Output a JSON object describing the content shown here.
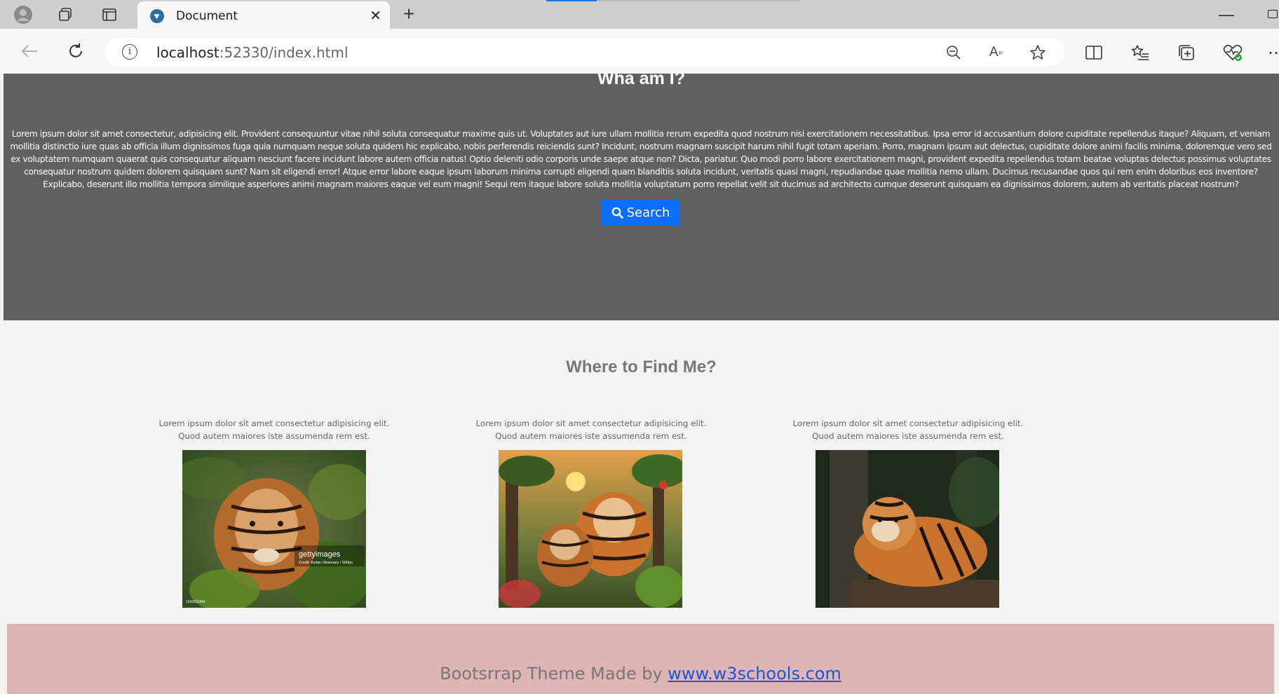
{
  "browser": {
    "tab_title": "Document",
    "url_host": "localhost",
    "url_rest": ":52330/index.html"
  },
  "hero": {
    "title": "Wha am I?",
    "body": "Lorem ipsum dolor sit amet consectetur, adipisicing elit. Provident consequuntur vitae nihil soluta consequatur maxime quis ut. Voluptates aut iure ullam mollitia rerum expedita quod nostrum nisi exercitationem necessitatibus. Ipsa error id accusantium dolore cupiditate repellendus itaque? Aliquam, et veniam mollitia distinctio iure quas ab officia illum dignissimos fuga quia numquam neque soluta quidem hic explicabo, nobis perferendis reiciendis sunt? Incidunt, nostrum magnam suscipit harum nihil fugit totam aperiam. Porro, magnam ipsum aut delectus, cupiditate dolore animi facilis minima, doloremque vero sed ex voluptatem numquam quaerat quis consequatur aliquam nesciunt facere incidunt labore autem officia natus! Optio deleniti odio corporis unde saepe atque non? Dicta, pariatur. Quo modi porro labore exercitationem magni, provident expedita repellendus totam beatae voluptas delectus possimus voluptates consequatur nostrum quidem dolorem quisquam sunt? Nam sit eligendi error! Atque error labore eaque ipsum laborum minima corrupti eligendi quam blanditiis soluta incidunt, veritatis quasi magni, repudiandae quae mollitia nemo ullam. Ducimus recusandae quos qui rem enim doloribus eos inventore? Explicabo, deserunt illo mollitia tempora similique asperiores animi magnam maiores eaque vel eum magni! Sequi rem itaque labore soluta mollitia voluptatum porro repellat velit sit ducimus ad architecto cumque deserunt quisquam ea dignissimos dolorem, autem ab veritatis placeat nostrum?",
    "search_label": "Search"
  },
  "where": {
    "title": "Where to Find Me?",
    "cards": [
      {
        "line1": "Lorem ipsum dolor sit amet consectetur adipisicing elit.",
        "line2": "Quod autem maiores iste assumenda rem est.",
        "watermark": "gettyimages",
        "credit": "Credit: Ketan Vikamsey / 500px",
        "code": "1330830984"
      },
      {
        "line1": "Lorem ipsum dolor sit amet consectetur adipisicing elit.",
        "line2": "Quod autem maiores iste assumenda rem est."
      },
      {
        "line1": "Lorem ipsum dolor sit amet consectetur adipisicing elit.",
        "line2": "Quod autem maiores iste assumenda rem est."
      }
    ]
  },
  "footer": {
    "text": "Bootsrrap Theme Made by ",
    "link": "www.w3schools.com"
  },
  "colors": {
    "hero_bg": "#606060",
    "button": "#0d6efd",
    "footer_bg": "#deb4b4",
    "link": "#1a56db"
  }
}
